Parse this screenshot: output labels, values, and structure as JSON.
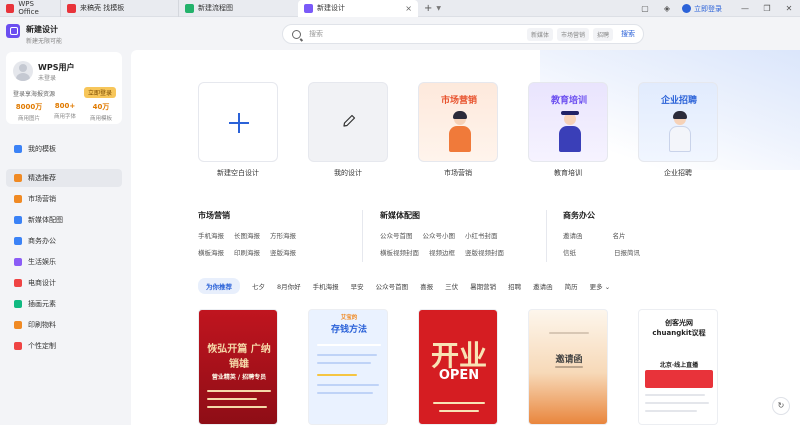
{
  "titlebar": {
    "tabs": [
      {
        "label": "WPS Office"
      },
      {
        "label": "来稿壳 找模板"
      },
      {
        "label": "新建流程图"
      },
      {
        "label": "新建设计"
      }
    ],
    "login_label": "立即登录"
  },
  "header": {
    "app_title": "新建设计",
    "app_subtitle": "新建无限可能",
    "search": {
      "placeholder": "搜索",
      "chips": [
        "新媒体",
        "市场营销",
        "招聘"
      ],
      "button": "搜索"
    }
  },
  "sidebar": {
    "user": {
      "name": "WPS用户",
      "status": "未登录",
      "promo": "登录享海报资源",
      "login_button": "立即登录",
      "stats": [
        {
          "value": "8000万",
          "label": "商用图片"
        },
        {
          "value": "800+",
          "label": "商用字体"
        },
        {
          "value": "40万",
          "label": "商用模板"
        }
      ]
    },
    "my_templates": "我的模板",
    "items": [
      {
        "label": "精选推荐",
        "color": "#f08a24"
      },
      {
        "label": "市场营销",
        "color": "#f08a24"
      },
      {
        "label": "新媒体配图",
        "color": "#3b82f6"
      },
      {
        "label": "商务办公",
        "color": "#3b82f6"
      },
      {
        "label": "生活娱乐",
        "color": "#8b5cf6"
      },
      {
        "label": "电商设计",
        "color": "#ef4444"
      },
      {
        "label": "插画元素",
        "color": "#10b981"
      },
      {
        "label": "印刷物料",
        "color": "#f08a24"
      },
      {
        "label": "个性定制",
        "color": "#ef4444"
      }
    ]
  },
  "main": {
    "quick": [
      {
        "label": "新建空白设计"
      },
      {
        "label": "我的设计"
      },
      {
        "label": "市场营销",
        "head": "市场营销",
        "color": "#e8542f"
      },
      {
        "label": "教育培训",
        "head": "教育培训",
        "color": "#6a4df0"
      },
      {
        "label": "企业招聘",
        "head": "企业招聘",
        "color": "#2b62d8"
      }
    ],
    "sections": [
      {
        "title": "市场营销",
        "links": [
          "手机海报",
          "长图海报",
          "方形海报",
          "横板海报",
          "印刷海报",
          "竖版海报"
        ]
      },
      {
        "title": "新媒体配图",
        "links": [
          "公众号首图",
          "公众号小图",
          "小红书封面",
          "横板视频封面",
          "视频边框",
          "竖版视频封面"
        ]
      },
      {
        "title": "商务办公",
        "links": [
          "邀请函",
          "名片",
          "信纸",
          "日报简讯"
        ]
      }
    ],
    "filters": [
      "为你推荐",
      "七夕",
      "8月你好",
      "手机海报",
      "早安",
      "公众号首图",
      "喜报",
      "三伏",
      "暑期营销",
      "招聘",
      "邀请函",
      "简历",
      "更多 ⌄"
    ],
    "templates": [
      {
        "title": "恢弘开篇 广纳销雄",
        "sub": "营业精英 / 招聘专员"
      },
      {
        "title": "存钱方法",
        "sub": "艾宝的"
      },
      {
        "title": "开业",
        "sub": "OPEN"
      },
      {
        "title": "邀请函",
        "sub": ""
      },
      {
        "title": "创客光网 chuangkit议程",
        "sub": "北京·线上直播"
      }
    ]
  }
}
